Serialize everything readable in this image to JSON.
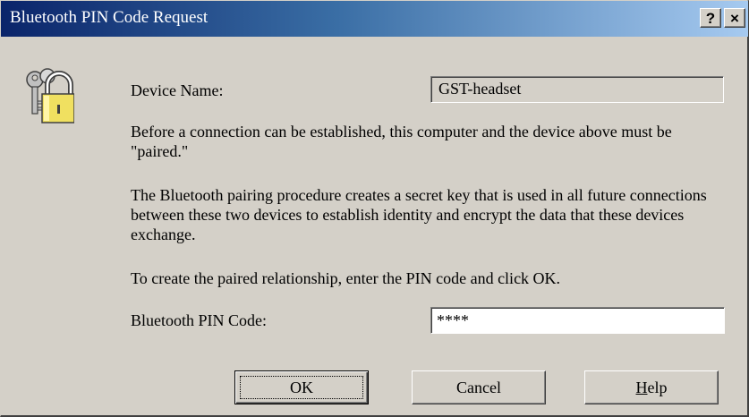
{
  "window": {
    "title": "Bluetooth PIN Code Request",
    "help_glyph": "?",
    "close_glyph": "×"
  },
  "icon": "keys-lock-icon",
  "device": {
    "label": "Device Name:",
    "value": "GST-headset"
  },
  "paragraphs": {
    "p1": "Before a connection can be established, this computer and the device above must be \"paired.\"",
    "p2": "The Bluetooth pairing procedure creates a secret key that is used in all future connections between these two devices to establish identity and encrypt the data that these devices exchange.",
    "p3": "To create the paired relationship, enter the PIN code and click OK."
  },
  "pin": {
    "label": "Bluetooth PIN Code:",
    "value": "****"
  },
  "buttons": {
    "ok": "OK",
    "cancel": "Cancel",
    "help_first": "H",
    "help_rest": "elp"
  },
  "colors": {
    "title_start": "#0a246a",
    "title_end": "#a6caf0",
    "face": "#d4d0c8"
  }
}
